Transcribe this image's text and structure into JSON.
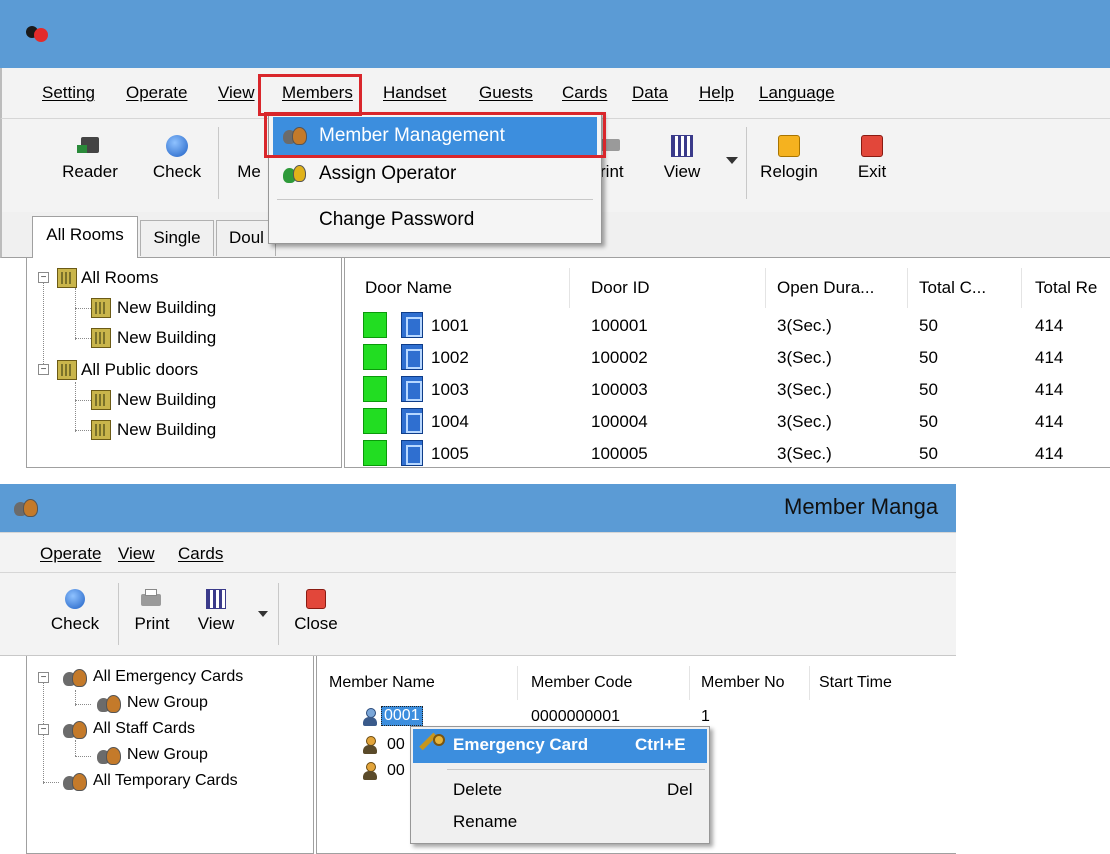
{
  "top_window": {
    "menu": [
      "Setting",
      "Operate",
      "View",
      "Members",
      "Handset",
      "Guests",
      "Cards",
      "Data",
      "Help",
      "Language"
    ],
    "toolbar": {
      "reader": "Reader",
      "check": "Check",
      "members_partial": "Me",
      "print_partial": "rint",
      "view": "View",
      "relogin": "Relogin",
      "exit": "Exit"
    },
    "tabs": [
      "All Rooms",
      "Single",
      "Doul"
    ],
    "members_dropdown": [
      "Member Management",
      "Assign Operator",
      "Change Password"
    ],
    "tree": {
      "all_rooms": "All Rooms",
      "building_1": "New Building",
      "building_2": "New Building",
      "public_doors": "All Public doors",
      "building_3": "New Building",
      "building_4": "New Building"
    },
    "table": {
      "columns": [
        "Door Name",
        "Door ID",
        "Open Dura...",
        "Total C...",
        "Total Re"
      ],
      "rows": [
        [
          "1001",
          "100001",
          "3(Sec.)",
          "50",
          "414"
        ],
        [
          "1002",
          "100002",
          "3(Sec.)",
          "50",
          "414"
        ],
        [
          "1003",
          "100003",
          "3(Sec.)",
          "50",
          "414"
        ],
        [
          "1004",
          "100004",
          "3(Sec.)",
          "50",
          "414"
        ],
        [
          "1005",
          "100005",
          "3(Sec.)",
          "50",
          "414"
        ]
      ]
    },
    "colors": {
      "title_bar": "#5b9bd5",
      "highlight": "#3c8ede",
      "red_callout": "#d9262b",
      "door_status": "#22dd22"
    }
  },
  "bottom_window": {
    "title": "Member Manga",
    "menu": [
      "Operate",
      "View",
      "Cards"
    ],
    "toolbar": {
      "check": "Check",
      "print": "Print",
      "view": "View",
      "close": "Close"
    },
    "tree": {
      "emergency": "All Emergency Cards",
      "group_1": "New Group",
      "staff": "All Staff Cards",
      "group_2": "New Group",
      "temporary": "All Temporary Cards"
    },
    "table": {
      "columns": [
        "Member Name",
        "Member Code",
        "Member No",
        "Start Time"
      ],
      "rows": [
        {
          "name": "0001",
          "code": "0000000001",
          "no": "1"
        },
        {
          "name": "00",
          "code": "",
          "no": ""
        },
        {
          "name": "00",
          "code": "",
          "no": ""
        }
      ]
    },
    "context_menu": {
      "emergency_card": "Emergency Card",
      "emergency_shortcut": "Ctrl+E",
      "delete": "Delete",
      "delete_shortcut": "Del",
      "rename": "Rename"
    }
  }
}
